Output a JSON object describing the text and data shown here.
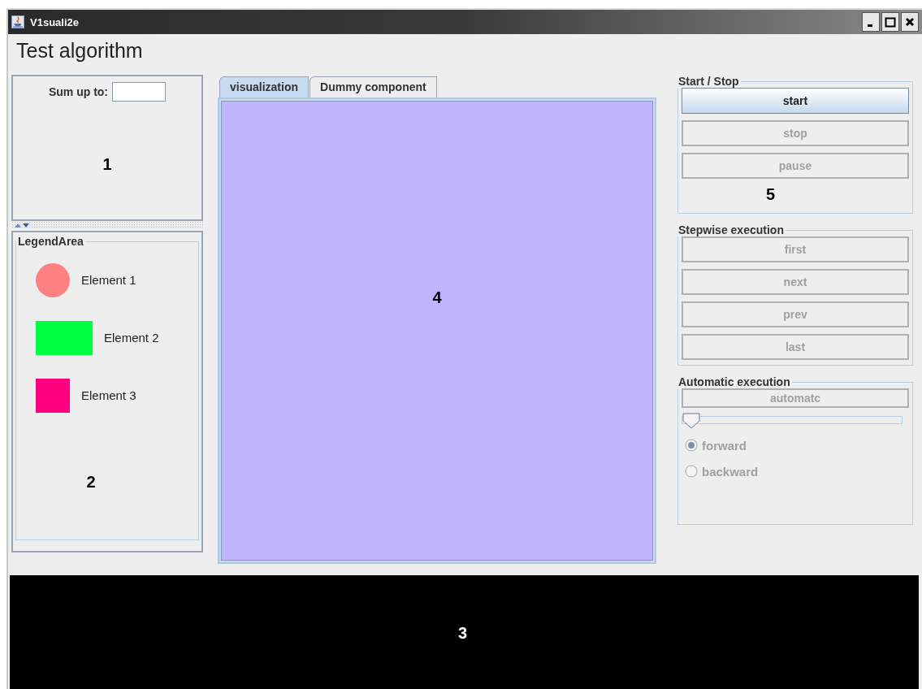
{
  "window": {
    "title": "V1suali2e",
    "controls": [
      {
        "kind": "minimize"
      },
      {
        "kind": "maximize"
      },
      {
        "kind": "close"
      }
    ]
  },
  "heading": "Test algorithm",
  "input_panel": {
    "label": "Sum up to:",
    "marker": "1"
  },
  "legend": {
    "title": "LegendArea",
    "items": [
      {
        "label": "Element 1",
        "kind": "circle",
        "color": "#ff8080"
      },
      {
        "label": "Element 2",
        "kind": "wide",
        "color": "#00ff40"
      },
      {
        "label": "Element 3",
        "kind": "square",
        "color": "#ff0080"
      }
    ],
    "marker": "2"
  },
  "tabs": [
    {
      "label": "visualization",
      "selected": true
    },
    {
      "label": "Dummy component",
      "selected": false
    }
  ],
  "visualization": {
    "marker": "4"
  },
  "console": {
    "marker": "3"
  },
  "start_stop": {
    "title": "Start / Stop",
    "buttons": [
      {
        "label": "start",
        "disabled": false
      },
      {
        "label": "stop",
        "disabled": true
      },
      {
        "label": "pause",
        "disabled": true
      }
    ],
    "marker": "5"
  },
  "stepwise": {
    "title": "Stepwise execution",
    "buttons": [
      {
        "label": "first",
        "disabled": true
      },
      {
        "label": "next",
        "disabled": true
      },
      {
        "label": "prev",
        "disabled": true
      },
      {
        "label": "last",
        "disabled": true
      }
    ]
  },
  "automatic": {
    "title": "Automatic execution",
    "button": {
      "label": "automatc",
      "disabled": true
    },
    "speed": {
      "level": 0,
      "disabled": true
    },
    "directions": [
      {
        "label": "forward",
        "selected": true,
        "disabled": true
      },
      {
        "label": "backward",
        "selected": false,
        "disabled": true
      }
    ]
  }
}
